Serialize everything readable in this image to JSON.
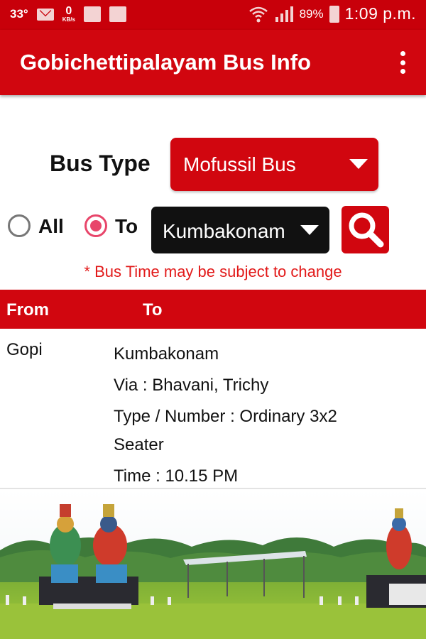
{
  "status_bar": {
    "temperature": "33°",
    "net_speed_value": "0",
    "net_speed_unit": "KB/s",
    "battery": "89%",
    "time": "1:09 p.m."
  },
  "app_bar": {
    "title": "Gobichettipalayam Bus Info"
  },
  "filters": {
    "bus_type_label": "Bus Type",
    "bus_type_value": "Mofussil Bus",
    "radio_all_label": "All",
    "radio_to_label": "To",
    "radio_selected": "To",
    "destination_value": "Kumbakonam"
  },
  "note": "* Bus Time may be subject to change",
  "table": {
    "columns": [
      "From",
      "To"
    ],
    "rows": [
      {
        "from": "Gopi",
        "to": "Kumbakonam",
        "via": "Via : Bhavani, Trichy",
        "type_number_line1": "Type / Number :  Ordinary 3x2",
        "type_number_line2": "Seater",
        "time": "Time : 10.15 PM"
      }
    ]
  },
  "colors": {
    "primary": "#d1060f",
    "status_bar": "#c8000a",
    "note_text": "#e21a1a",
    "radio_accent": "#e8456a",
    "dropdown_dark": "#111111"
  }
}
